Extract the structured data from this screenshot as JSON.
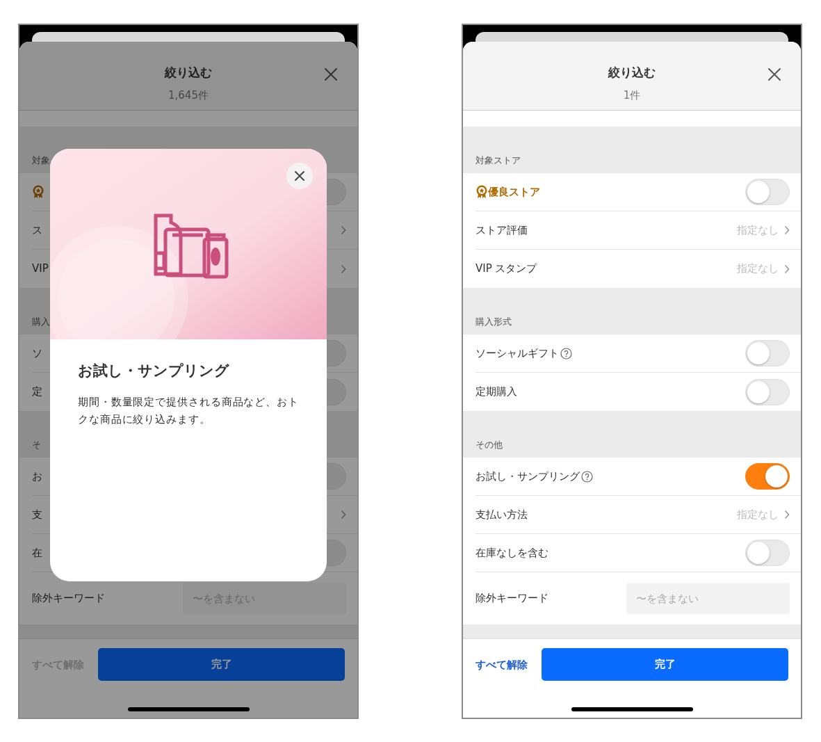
{
  "screens": [
    {
      "header": {
        "title": "絞り込む",
        "count": "1,645件"
      },
      "sections": [
        {
          "title": "対象",
          "rows": [
            {
              "kind": "badge_toggle",
              "on": false
            },
            {
              "kind": "link",
              "label": "ス"
            },
            {
              "kind": "link",
              "label": "VIP"
            }
          ]
        },
        {
          "title": "購入",
          "rows": [
            {
              "kind": "toggle",
              "label": "ソ",
              "on": false
            },
            {
              "kind": "toggle",
              "label": "定",
              "on": false
            }
          ]
        },
        {
          "title": "そ",
          "rows": [
            {
              "kind": "toggle",
              "label": "お",
              "on": false
            },
            {
              "kind": "link",
              "label": "支"
            },
            {
              "kind": "toggle",
              "label": "在",
              "on": false
            },
            {
              "kind": "input",
              "label": "除外キーワード",
              "placeholder": "〜を含まない"
            }
          ]
        }
      ],
      "footer": {
        "clear": "すべて解除",
        "clear_disabled": true,
        "done": "完了"
      },
      "dialog": {
        "title": "お試し・サンプリング",
        "description": "期間・数量限定で提供される商品など、おトクな商品に絞り込みます。"
      }
    },
    {
      "header": {
        "title": "絞り込む",
        "count": "1件"
      },
      "sections": [
        {
          "title": "対象ストア",
          "rows": [
            {
              "kind": "badge_toggle",
              "label": "優良ストア",
              "on": false
            },
            {
              "kind": "link",
              "label": "ストア評価",
              "value": "指定なし"
            },
            {
              "kind": "link",
              "label": "VIP スタンプ",
              "value": "指定なし"
            }
          ]
        },
        {
          "title": "購入形式",
          "rows": [
            {
              "kind": "toggle",
              "label": "ソーシャルギフト",
              "help": true,
              "on": false
            },
            {
              "kind": "toggle",
              "label": "定期購入",
              "on": false
            }
          ]
        },
        {
          "title": "その他",
          "rows": [
            {
              "kind": "toggle",
              "label": "お試し・サンプリング",
              "help": true,
              "on": true
            },
            {
              "kind": "link",
              "label": "支払い方法",
              "value": "指定なし"
            },
            {
              "kind": "toggle",
              "label": "在庫なしを含む",
              "on": false
            },
            {
              "kind": "input",
              "label": "除外キーワード",
              "placeholder": "〜を含まない"
            }
          ]
        }
      ],
      "footer": {
        "clear": "すべて解除",
        "clear_disabled": false,
        "done": "完了"
      }
    }
  ]
}
